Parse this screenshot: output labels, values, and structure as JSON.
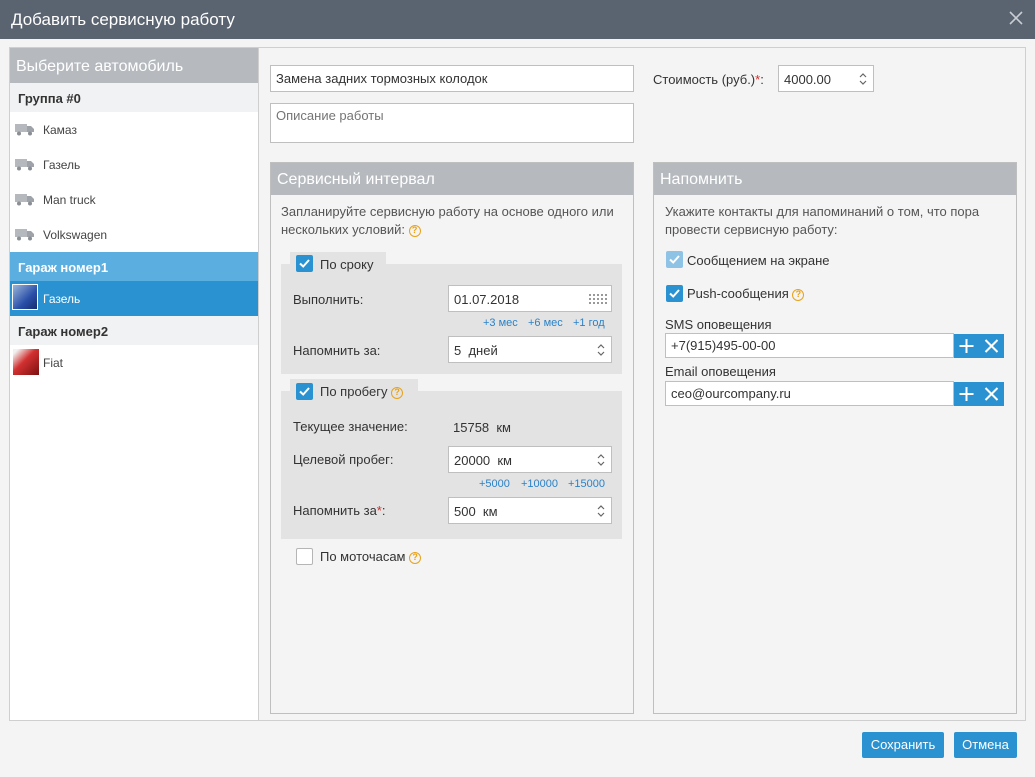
{
  "dialog": {
    "title": "Добавить сервисную работу"
  },
  "sidebar": {
    "heading": "Выберите автомобиль",
    "groups": [
      {
        "label": "Группа #0",
        "items": [
          "Камаз",
          "Газель",
          "Man truck",
          "Volkswagen"
        ]
      },
      {
        "label": "Гараж номер1",
        "items": [
          "Газель"
        ]
      },
      {
        "label": "Гараж номер2",
        "items": [
          "Fiat"
        ]
      }
    ]
  },
  "work": {
    "name_value": "Замена задних тормозных колодок",
    "description_placeholder": "Описание работы",
    "cost_label": "Стоимость (руб.)",
    "cost_required": "*",
    "cost_sep": ":",
    "cost_value": "4000.00"
  },
  "interval": {
    "heading": "Сервисный интервал",
    "desc": "Запланируйте сервисную работу на основе одного или нескольких условий:",
    "by_date": {
      "label": "По сроку",
      "checked": true,
      "execute_label": "Выполнить:",
      "execute_value": "01.07.2018",
      "quick": [
        "+3 мес",
        "+6 мес",
        "+1 год"
      ],
      "remind_label": "Напомнить за:",
      "remind_value": "5  дней"
    },
    "by_mileage": {
      "label": "По пробегу",
      "checked": true,
      "current_label": "Текущее значение:",
      "current_value": "15758  км",
      "target_label": "Целевой пробег:",
      "target_value": "20000  км",
      "quick": [
        "+5000",
        "+10000",
        "+15000"
      ],
      "remind_label": "Напомнить за",
      "remind_required": "*",
      "remind_sep": ":",
      "remind_value": "500  км"
    },
    "by_hours": {
      "label": "По моточасам",
      "checked": false
    }
  },
  "remind": {
    "heading": "Напомнить",
    "desc": "Укажите контакты для напоминаний о том, что пора провести сервисную работу:",
    "screen_label": "Сообщением на экране",
    "push_label": "Push-сообщения",
    "sms_label": "SMS оповещения",
    "sms_value": "+7(915)495-00-00",
    "email_label": "Email оповещения",
    "email_value": "ceo@ourcompany.ru"
  },
  "footer": {
    "save": "Сохранить",
    "cancel": "Отмена"
  },
  "colors": {
    "accent": "#2a92d0",
    "title_bar": "#5a6370",
    "panel_header": "#b6babf",
    "required": "#d42b2b"
  }
}
